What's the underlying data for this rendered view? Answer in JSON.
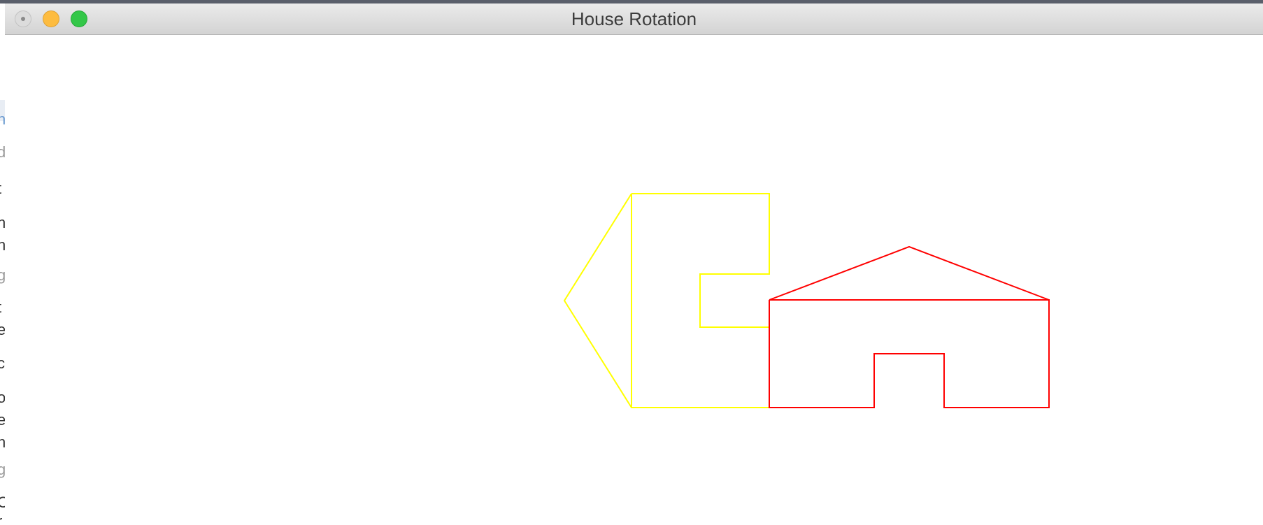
{
  "window": {
    "title": "House Rotation",
    "controls": [
      "close",
      "minimize",
      "zoom"
    ]
  },
  "drawing": {
    "background": "#ffffff",
    "shapes": [
      {
        "name": "rotated-house",
        "color": "#ffff00"
      },
      {
        "name": "original-house",
        "color": "#ff0000"
      }
    ]
  },
  "background_window_fragments": [
    "n",
    "d",
    "t",
    "n",
    "n",
    "g",
    "t",
    "e",
    "c",
    "o",
    "e",
    "n",
    "g",
    "C",
    "r"
  ]
}
